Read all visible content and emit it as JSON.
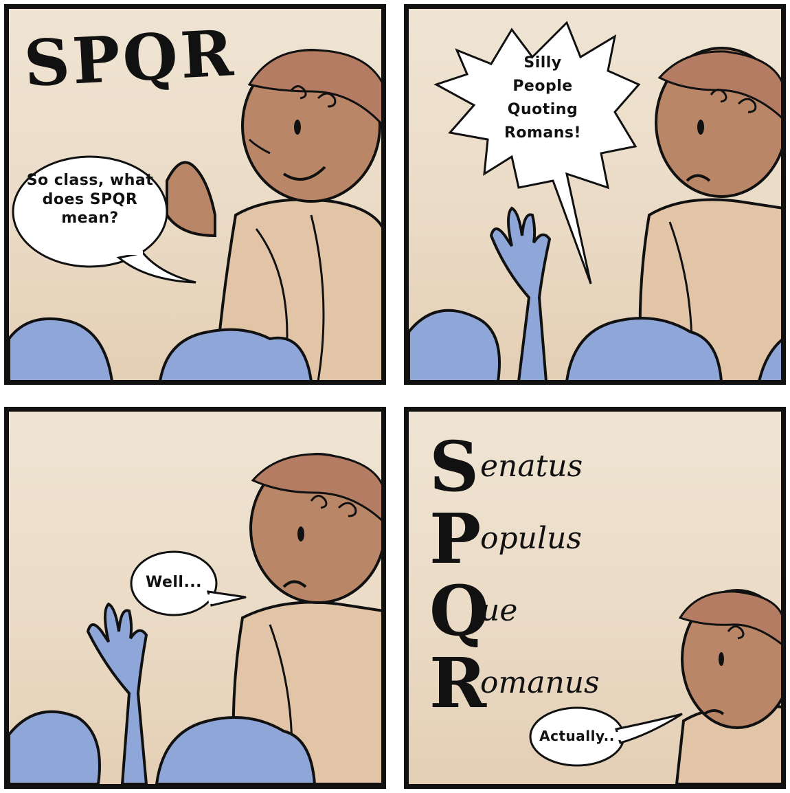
{
  "panels": [
    {
      "title": "SPQR",
      "speech": [
        "So class, what",
        "does SPQR",
        "mean?"
      ]
    },
    {
      "speech": [
        "Silly",
        "People",
        "Quoting",
        "Romans!"
      ]
    },
    {
      "speech": [
        "Well..."
      ]
    },
    {
      "acronym": [
        {
          "letter": "S",
          "rest": "enatus"
        },
        {
          "letter": "P",
          "rest": "opulus"
        },
        {
          "letter": "Q",
          "rest": "ue"
        },
        {
          "letter": "R",
          "rest": "omanus"
        }
      ],
      "speech": [
        "Actually.."
      ]
    }
  ],
  "colors": {
    "border": "#111111",
    "background": "#efe4d3",
    "skin": "#b98668",
    "hair": "#b37c63",
    "toga": "#e2c4a6",
    "student_blue": "#8fa6d8"
  },
  "icons": [
    "teacher-figure",
    "student-head",
    "raised-hand",
    "speech-bubble"
  ]
}
